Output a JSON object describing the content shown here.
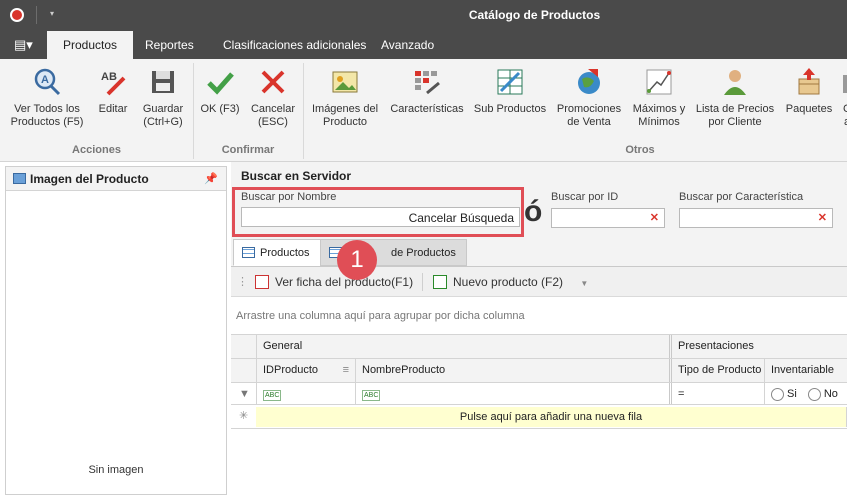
{
  "window": {
    "title": "Catálogo de Productos",
    "app_icon": "app-logo-icon",
    "quick_access": "▾"
  },
  "tabs": [
    {
      "label": "Productos",
      "active": true
    },
    {
      "label": "Reportes",
      "active": false
    },
    {
      "label": "Clasificaciones adicionales",
      "active": false
    },
    {
      "label": "Avanzado",
      "active": false
    }
  ],
  "ribbon": {
    "groups": [
      {
        "label": "Acciones"
      },
      {
        "label": "Confirmar"
      },
      {
        "label": "Otros"
      }
    ],
    "buttons": {
      "ver_todos": "Ver Todos los Productos (F5)",
      "editar": "Editar",
      "guardar": "Guardar (Ctrl+G)",
      "ok": "OK (F3)",
      "cancelar": "Cancelar (ESC)",
      "imagenes": "Imágenes del Producto",
      "caracteristicas": "Características",
      "sub_productos": "Sub Productos",
      "promociones": "Promociones de Venta",
      "maximos": "Máximos y Mínimos",
      "lista_precios": "Lista de Precios por Cliente",
      "paquetes": "Paquetes",
      "cut": "C a"
    }
  },
  "left_panel": {
    "title": "Imagen del Producto",
    "pin": "📌",
    "no_image": "Sin imagen"
  },
  "search": {
    "title": "Buscar en Servidor",
    "by_name_label": "Buscar por Nombre",
    "by_name_cancel": "Cancelar Búsqueda",
    "big_glyph": "ó",
    "by_id_label": "Buscar por ID",
    "by_feature_label": "Buscar por Característica",
    "clear": "✕"
  },
  "subtabs": [
    {
      "label": "Productos",
      "active": true
    },
    {
      "label": "de Productos",
      "active": false
    }
  ],
  "badge": "1",
  "toolbar": {
    "grip": "⋮",
    "ver_ficha": "Ver ficha del producto(F1)",
    "nuevo": "Nuevo producto (F2)",
    "dropdown": "▼"
  },
  "grid": {
    "group_by_hint": "Arrastre una columna aquí para agrupar por dicha columna",
    "bands": {
      "general": "General",
      "presentaciones": "Presentaciones"
    },
    "columns": {
      "id": "IDProducto",
      "nombre": "NombreProducto",
      "tipo": "Tipo de Producto",
      "inventariable": "Inventariable"
    },
    "filter": {
      "abc": "ABC",
      "equals": "=",
      "si": "Si",
      "no": "No",
      "filter_icon": "▼"
    },
    "new_row": {
      "marker": "✳",
      "text": "Pulse aquí para añadir una nueva fila"
    },
    "sort_icon": "≡"
  }
}
